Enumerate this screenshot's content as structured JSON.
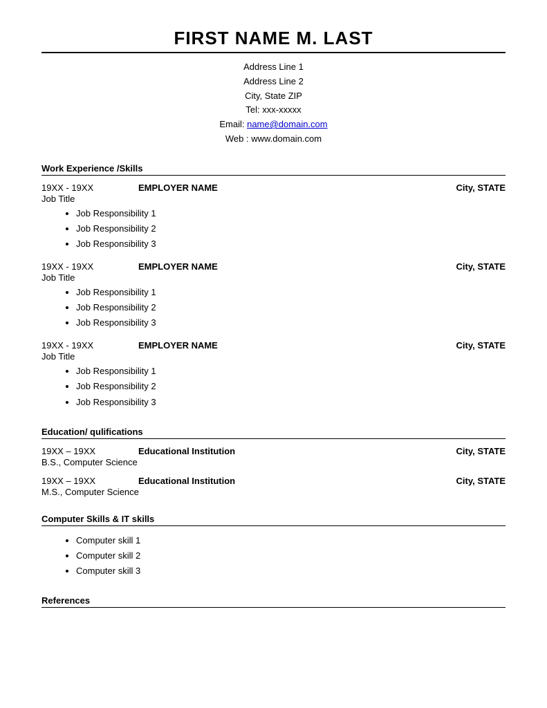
{
  "header": {
    "full_name": "FIRST NAME M. LAST",
    "address_line1": "Address Line 1",
    "address_line2": "Address Line 2",
    "city_state_zip": "City, State ZIP",
    "tel": "Tel: xxx-xxxxx",
    "email_label": "Email: ",
    "email_value": "name@domain.com",
    "email_href": "mailto:name@domain.com",
    "web": "Web : www.domain.com"
  },
  "sections": {
    "work_experience_title": "Work Experience /Skills",
    "education_title": "Education/ qulifications",
    "computer_skills_title": "Computer Skills & IT skills",
    "references_title": "References"
  },
  "jobs": [
    {
      "dates": "19XX - 19XX",
      "employer": "EMPLOYER NAME",
      "location": "City, STATE",
      "title": "Job Title",
      "responsibilities": [
        "Job Responsibility 1",
        "Job Responsibility 2",
        "Job Responsibility 3"
      ]
    },
    {
      "dates": "19XX - 19XX",
      "employer": "EMPLOYER NAME",
      "location": "City, STATE",
      "title": "Job Title",
      "responsibilities": [
        "Job Responsibility 1",
        "Job Responsibility 2",
        "Job Responsibility 3"
      ]
    },
    {
      "dates": "19XX - 19XX",
      "employer": "EMPLOYER NAME",
      "location": "City, STATE",
      "title": "Job Title",
      "responsibilities": [
        "Job Responsibility 1",
        "Job Responsibility 2",
        "Job Responsibility 3"
      ]
    }
  ],
  "education": [
    {
      "dates": "19XX – 19XX",
      "institution": "Educational Institution",
      "location": "City, STATE",
      "degree": "B.S., Computer Science"
    },
    {
      "dates": "19XX – 19XX",
      "institution": "Educational Institution",
      "location": "City, STATE",
      "degree": "M.S., Computer Science"
    }
  ],
  "computer_skills": [
    "Computer skill 1",
    "Computer skill 2",
    "Computer skill 3"
  ]
}
